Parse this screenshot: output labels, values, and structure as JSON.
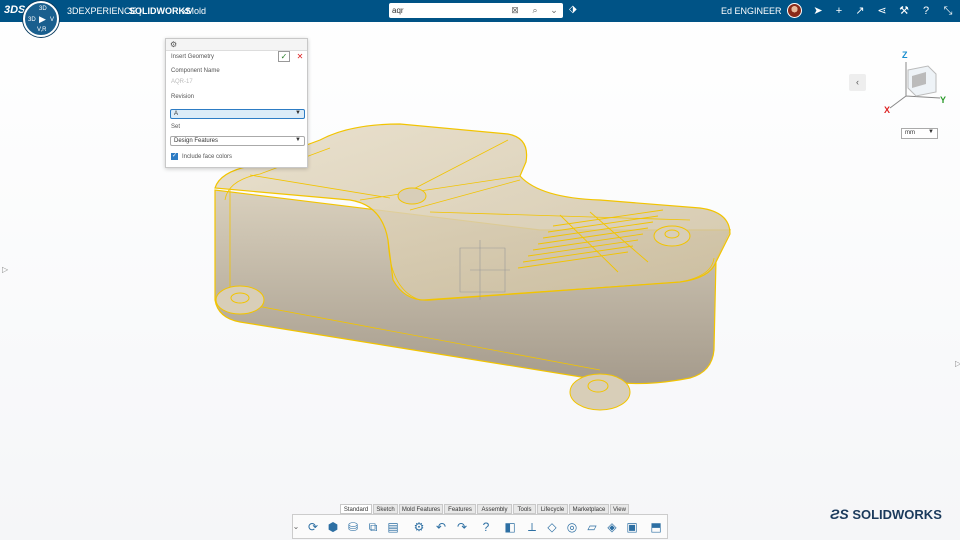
{
  "topbar": {
    "brand_prefix": "3DEXPERIENCE | ",
    "brand_main": "SOLIDWORKS",
    "app": "xMold",
    "ds_logo": "3DS",
    "compass": {
      "top": "3D",
      "left": "3D",
      "right": "V",
      "bottom": "V,R"
    }
  },
  "search": {
    "value": "aqr",
    "icons": [
      "clear-icon",
      "search-icon",
      "chevron-down-icon"
    ]
  },
  "user": {
    "name": "Ed ENGINEER"
  },
  "top_icons": [
    "compass-arrow-icon",
    "plus-icon",
    "share-arrow-icon",
    "network-share-icon",
    "tools-icon",
    "help-icon",
    "collapse-icon"
  ],
  "panel": {
    "title": "Insert Geometry",
    "component_name_label": "Component Name",
    "component_name_placeholder": "AQR-17",
    "revision_label": "Revision",
    "revision_value": "A",
    "set_label": "Set",
    "set_value": "Design Features",
    "include_face_colors_label": "Include face colors",
    "include_face_colors": true
  },
  "view": {
    "units": "mm",
    "axes": {
      "x": "X",
      "y": "Y",
      "z": "Z"
    }
  },
  "tabs": [
    {
      "label": "Standard",
      "active": true
    },
    {
      "label": "Sketch"
    },
    {
      "label": "Mold Features"
    },
    {
      "label": "Features"
    },
    {
      "label": "Assembly"
    },
    {
      "label": "Tools"
    },
    {
      "label": "Lifecycle"
    },
    {
      "label": "Marketplace"
    },
    {
      "label": "View"
    }
  ],
  "toolbar_icons": [
    "rebuild-icon",
    "part-icon",
    "save-icon",
    "assembly-icon",
    "options-icon",
    "settings-icon",
    "undo-icon",
    "redo-icon",
    "help-icon",
    "tooling-split-icon",
    "parting-line-icon",
    "parting-surface-icon",
    "shut-off-icon",
    "core-icon",
    "cavity-icon",
    "mold-box-icon"
  ],
  "footer_logo": "SOLIDWORKS",
  "colors": {
    "topbar": "#005386",
    "accent": "#f2c400",
    "model_face": "#c9bea8",
    "panel_select": "#2d7cc4"
  }
}
